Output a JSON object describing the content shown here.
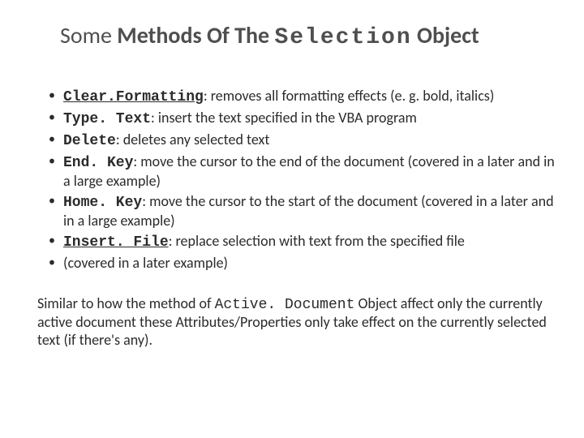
{
  "title": {
    "some": "Some",
    "methods": "Methods",
    "ofthe": "Of The",
    "selection": "Selection",
    "object": "Object"
  },
  "bullets": [
    {
      "method": "Clear.Formatting",
      "underline": true,
      "desc": ": removes all formatting effects (e. g. bold, italics)"
    },
    {
      "method": "Type. Text",
      "underline": false,
      "desc": ": insert the text specified in the VBA program"
    },
    {
      "method": "Delete",
      "underline": false,
      "desc": ": deletes any selected text"
    },
    {
      "method": "End. Key",
      "underline": false,
      "desc": ": move the cursor to the end of the document (covered in a later and in a large example)"
    },
    {
      "method": "Home. Key",
      "underline": false,
      "desc": ": move the cursor to the start of the document (covered in a later and in a large example)"
    },
    {
      "method": "Insert. File",
      "underline": true,
      "desc": ": replace selection with text from the specified file"
    },
    {
      "method": "",
      "underline": false,
      "desc": "(covered in a later example)"
    }
  ],
  "footer": {
    "pre": "Similar to how the method of ",
    "mono": "Active. Document",
    "post": " Object affect only the currently active document these Attributes/Properties only take effect on the currently selected text (if there's any)."
  }
}
